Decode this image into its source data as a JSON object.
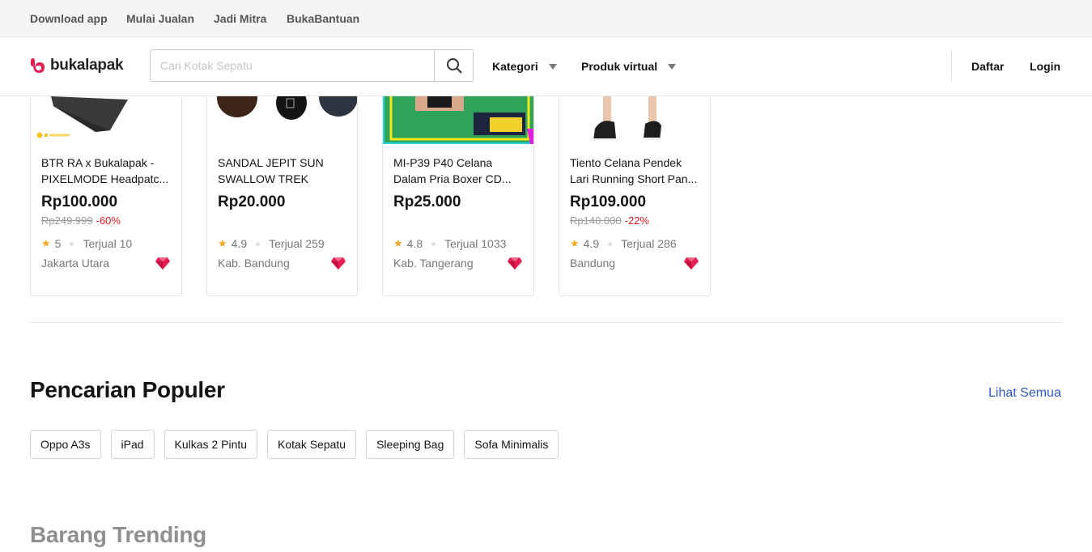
{
  "topbar": {
    "links": [
      "Download app",
      "Mulai Jualan",
      "Jadi Mitra",
      "BukaBantuan"
    ]
  },
  "header": {
    "logo_text": "bukalapak",
    "search_placeholder": "Cari Kotak Sepatu",
    "menus": [
      "Kategori",
      "Produk virtual"
    ],
    "register_label": "Daftar",
    "login_label": "Login"
  },
  "products": [
    {
      "title": "BTR RA x Bukalapak - PIXELMODE Headpatc...",
      "price": "Rp100.000",
      "old_price": "Rp249.999",
      "discount": "-60%",
      "rating": "5",
      "sold": "Terjual 10",
      "location": "Jakarta Utara"
    },
    {
      "title": "SANDAL JEPIT SUN SWALLOW TREK",
      "price": "Rp20.000",
      "old_price": "",
      "discount": "",
      "rating": "4.9",
      "sold": "Terjual 259",
      "location": "Kab. Bandung"
    },
    {
      "title": "MI-P39 P40 Celana Dalam Pria Boxer CD...",
      "price": "Rp25.000",
      "old_price": "",
      "discount": "",
      "rating": "4.8",
      "sold": "Terjual 1033",
      "location": "Kab. Tangerang"
    },
    {
      "title": "Tiento Celana Pendek Lari Running Short Pan...",
      "price": "Rp109.000",
      "old_price": "Rp140.000",
      "discount": "-22%",
      "rating": "4.9",
      "sold": "Terjual 286",
      "location": "Bandung"
    }
  ],
  "popular": {
    "title": "Pencarian Populer",
    "see_all": "Lihat Semua",
    "chips": [
      "Oppo A3s",
      "iPad",
      "Kulkas 2 Pintu",
      "Kotak Sepatu",
      "Sleeping Bag",
      "Sofa Minimalis"
    ]
  },
  "trending": {
    "title": "Barang Trending"
  },
  "colors": {
    "brand": "#e31e52",
    "link": "#2f59c2",
    "discount": "#e0191f",
    "star": "#f5a623"
  }
}
